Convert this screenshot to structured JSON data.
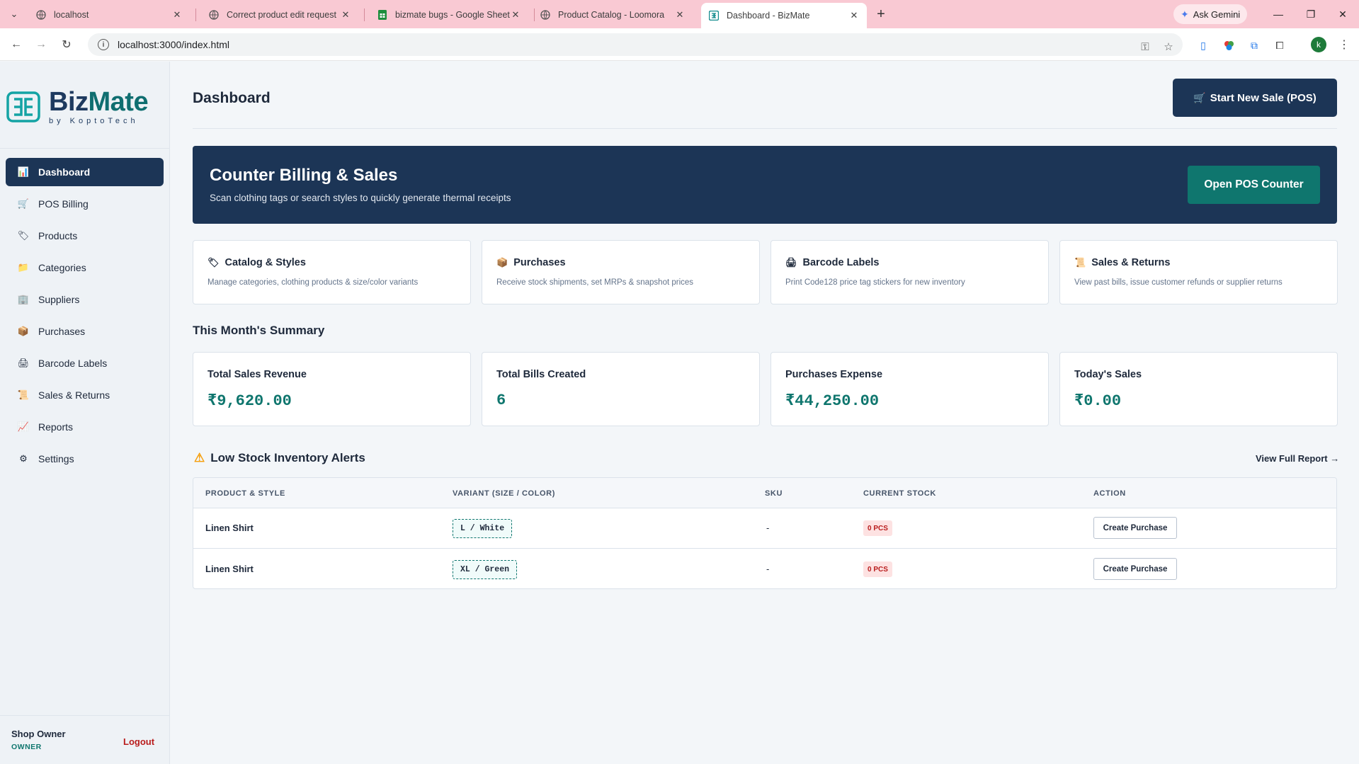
{
  "browser": {
    "tabs": [
      {
        "title": "localhost",
        "icon": "globe-icon"
      },
      {
        "title": "Correct product edit request",
        "icon": "globe-icon"
      },
      {
        "title": "bizmate bugs - Google Sheets",
        "icon": "sheets-icon"
      },
      {
        "title": "Product Catalog - Loomora",
        "icon": "globe-icon"
      },
      {
        "title": "Dashboard - BizMate",
        "icon": "bizmate-icon",
        "active": true
      }
    ],
    "ask_gemini": "Ask Gemini",
    "url": "localhost:3000/index.html",
    "profile_initial": "k"
  },
  "brand": {
    "name_first": "Biz",
    "name_second": "Mate",
    "tagline": "by KoptoTech"
  },
  "sidebar": {
    "items": [
      {
        "label": "Dashboard",
        "icon": "chart-icon",
        "active": true
      },
      {
        "label": "POS Billing",
        "icon": "cart-icon"
      },
      {
        "label": "Products",
        "icon": "tag-icon"
      },
      {
        "label": "Categories",
        "icon": "folder-icon"
      },
      {
        "label": "Suppliers",
        "icon": "building-icon"
      },
      {
        "label": "Purchases",
        "icon": "package-icon"
      },
      {
        "label": "Barcode Labels",
        "icon": "printer-icon"
      },
      {
        "label": "Sales & Returns",
        "icon": "receipt-icon"
      },
      {
        "label": "Reports",
        "icon": "trend-icon"
      },
      {
        "label": "Settings",
        "icon": "gear-icon"
      }
    ],
    "user": {
      "name": "Shop Owner",
      "role": "OWNER",
      "logout": "Logout"
    }
  },
  "header": {
    "title": "Dashboard",
    "new_sale_label": "Start New Sale (POS)"
  },
  "hero": {
    "title": "Counter Billing & Sales",
    "subtitle": "Scan clothing tags or search styles to quickly generate thermal receipts",
    "button": "Open POS Counter"
  },
  "quick_cards": [
    {
      "title": "Catalog & Styles",
      "icon": "tag-icon",
      "desc": "Manage categories, clothing products & size/color variants"
    },
    {
      "title": "Purchases",
      "icon": "package-icon",
      "desc": "Receive stock shipments, set MRPs & snapshot prices"
    },
    {
      "title": "Barcode Labels",
      "icon": "printer-icon",
      "desc": "Print Code128 price tag stickers for new inventory"
    },
    {
      "title": "Sales & Returns",
      "icon": "receipt-icon",
      "desc": "View past bills, issue customer refunds or supplier returns"
    }
  ],
  "summary": {
    "title": "This Month's Summary",
    "cards": [
      {
        "label": "Total Sales Revenue",
        "value": "₹9,620.00"
      },
      {
        "label": "Total Bills Created",
        "value": "6"
      },
      {
        "label": "Purchases Expense",
        "value": "₹44,250.00"
      },
      {
        "label": "Today's Sales",
        "value": "₹0.00"
      }
    ]
  },
  "low_stock": {
    "title": "Low Stock Inventory Alerts",
    "view_full": "View Full Report →",
    "columns": [
      "PRODUCT & STYLE",
      "VARIANT (SIZE / COLOR)",
      "SKU",
      "CURRENT STOCK",
      "ACTION"
    ],
    "rows": [
      {
        "product": "Linen Shirt",
        "variant": "L / White",
        "sku": "-",
        "stock": "0 PCS",
        "action": "Create Purchase"
      },
      {
        "product": "Linen Shirt",
        "variant": "XL / Green",
        "sku": "-",
        "stock": "0 PCS",
        "action": "Create Purchase"
      }
    ]
  },
  "colors": {
    "navy": "#1c3556",
    "teal": "#0f766e",
    "tab_bar": "#f9c9d3",
    "danger": "#b91c1c"
  }
}
